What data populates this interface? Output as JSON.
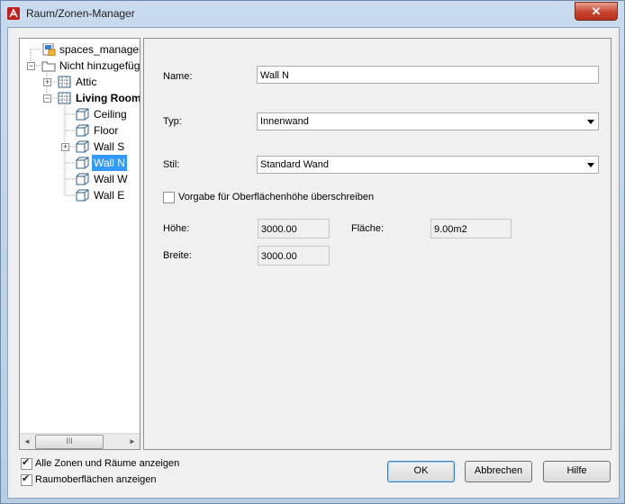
{
  "window": {
    "title": "Raum/Zonen-Manager",
    "close_glyph": "✕"
  },
  "tree": {
    "items": [
      {
        "label": "spaces_manager_",
        "icon": "drawing-file-icon"
      },
      {
        "label": "Nicht hinzugefüg",
        "icon": "folder-icon"
      },
      {
        "label": "Attic",
        "icon": "space-grid-icon"
      },
      {
        "label": "Living Room",
        "icon": "space-grid-icon"
      },
      {
        "label": "Ceiling",
        "icon": "surface-icon"
      },
      {
        "label": "Floor",
        "icon": "surface-icon"
      },
      {
        "label": "Wall S",
        "icon": "surface-icon"
      },
      {
        "label": "Wall N",
        "icon": "surface-icon"
      },
      {
        "label": "Wall W",
        "icon": "surface-icon"
      },
      {
        "label": "Wall E",
        "icon": "surface-icon"
      }
    ],
    "selected": "Wall N",
    "scroll_thumb_glyph": "III",
    "scroll_left_glyph": "◄",
    "scroll_right_glyph": "►"
  },
  "form": {
    "name_label": "Name:",
    "name_value": "Wall N",
    "typ_label": "Typ:",
    "typ_value": "Innenwand",
    "stil_label": "Stil:",
    "stil_value": "Standard Wand",
    "override_label": "Vorgabe für Oberflächenhöhe überschreiben",
    "override_checked": false,
    "hoehe_label": "Höhe:",
    "hoehe_value": "3000.00",
    "flaeche_label": "Fläche:",
    "flaeche_value": "9.00m2",
    "breite_label": "Breite:",
    "breite_value": "3000.00"
  },
  "footer": {
    "show_all_label": "Alle Zonen und Räume anzeigen",
    "show_all_checked": true,
    "show_surfaces_label": "Raumoberflächen anzeigen",
    "show_surfaces_checked": true,
    "ok_label": "OK",
    "cancel_label": "Abbrechen",
    "help_label": "Hilfe"
  }
}
